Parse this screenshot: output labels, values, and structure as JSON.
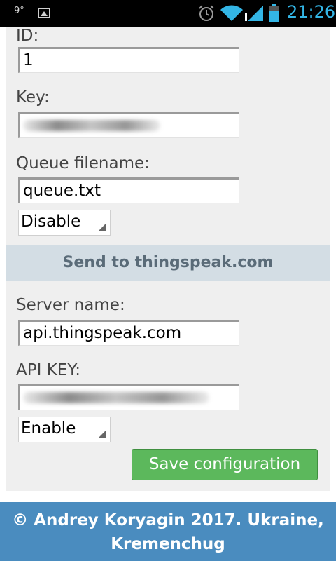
{
  "status_bar": {
    "temperature": "9°",
    "time": "21:26"
  },
  "form": {
    "id_label": "ID:",
    "id_value": "1",
    "key_label": "Key:",
    "queue_label": "Queue filename:",
    "queue_value": "queue.txt",
    "queue_select": "Disable",
    "section_title": "Send to thingspeak.com",
    "server_label": "Server name:",
    "server_value": "api.thingspeak.com",
    "apikey_label": "API KEY:",
    "thingspeak_select": "Enable",
    "save_label": "Save configuration"
  },
  "footer": {
    "text": "© Andrey Koryagin 2017. Ukraine, Kremenchug"
  },
  "colors": {
    "section_bg": "#d3dde4",
    "save_button": "#5cb85c",
    "footer_bg": "#4a8cbf",
    "clock": "#33b5e5"
  }
}
